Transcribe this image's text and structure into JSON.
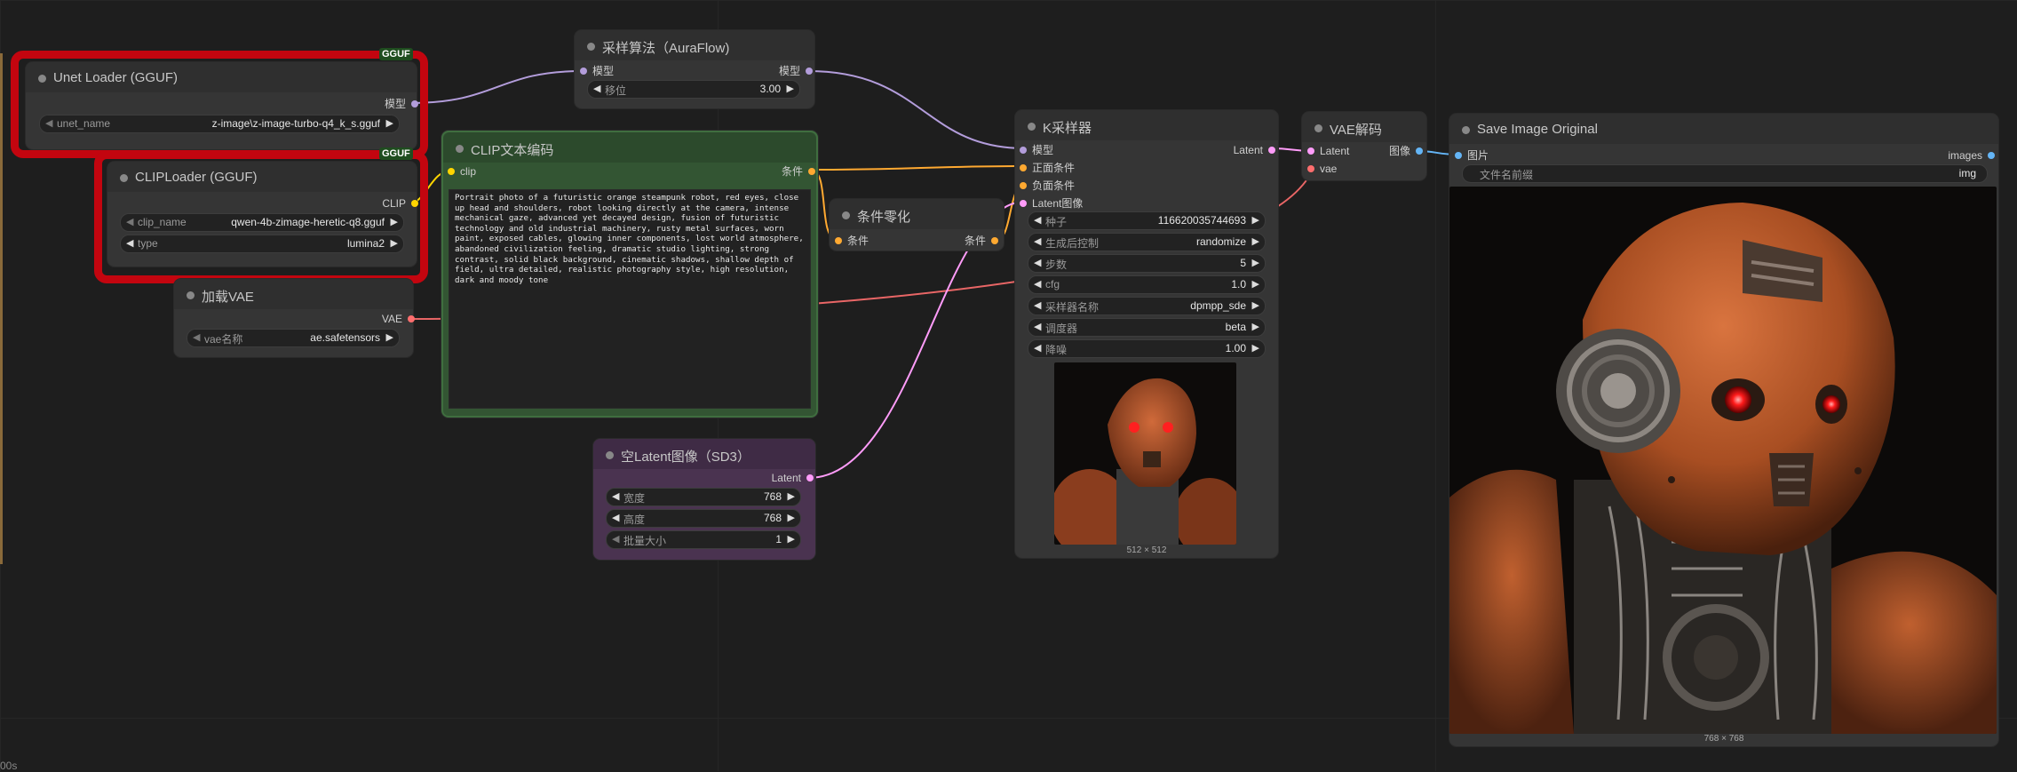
{
  "colors": {
    "canvas": "#1e1e1e",
    "node_body": "#353535",
    "node_header": "#2f2f2f",
    "selection": "#c3050f",
    "model_wire": "#b39ddb",
    "clip_wire": "#ffd500",
    "vae_wire": "#ff6e6e",
    "conditioning_wire": "#ffa931",
    "latent_wire": "#ff9cf9",
    "image_wire": "#64b5f6"
  },
  "nodes": {
    "unet_loader": {
      "badge": "GGUF",
      "title": "Unet Loader (GGUF)",
      "out_model": "模型",
      "w_unet_name_label": "unet_name",
      "w_unet_name_value": "z-image\\z-image-turbo-q4_k_s.gguf"
    },
    "clip_loader": {
      "badge": "GGUF",
      "title": "CLIPLoader (GGUF)",
      "out_clip": "CLIP",
      "w_clip_name_label": "clip_name",
      "w_clip_name_value": "qwen-4b-zimage-heretic-q8.gguf",
      "w_type_label": "type",
      "w_type_value": "lumina2"
    },
    "vae_loader": {
      "title": "加载VAE",
      "out_vae": "VAE",
      "w_vae_label": "vae名称",
      "w_vae_value": "ae.safetensors"
    },
    "sampling_algo": {
      "title": "采样算法（AuraFlow)",
      "in_model": "模型",
      "out_model": "模型",
      "w_shift_label": "移位",
      "w_shift_value": "3.00"
    },
    "clip_text_encode": {
      "title": "CLIP文本编码",
      "in_clip": "clip",
      "out_cond": "条件",
      "prompt": "Portrait photo of a futuristic orange steampunk robot, red eyes, close up head and shoulders, robot looking directly at the camera, intense mechanical gaze, advanced yet decayed design, fusion of futuristic technology and old industrial machinery, rusty metal surfaces, worn paint, exposed cables, glowing inner components, lost world atmosphere, abandoned civilization feeling, dramatic studio lighting, strong contrast, solid black background, cinematic shadows, shallow depth of field, ultra detailed, realistic photography style, high resolution, dark and moody tone"
    },
    "cond_zero": {
      "title": "条件零化",
      "in_cond": "条件",
      "out_cond": "条件"
    },
    "empty_latent": {
      "title": "空Latent图像（SD3）",
      "out_latent": "Latent",
      "w_width_label": "宽度",
      "w_width_value": "768",
      "w_height_label": "高度",
      "w_height_value": "768",
      "w_batch_label": "批量大小",
      "w_batch_value": "1"
    },
    "ksampler": {
      "title": "K采样器",
      "in_model": "模型",
      "in_positive": "正面条件",
      "in_negative": "负面条件",
      "in_latent": "Latent图像",
      "out_latent": "Latent",
      "w_seed_label": "种子",
      "w_seed_value": "116620035744693",
      "w_control_label": "生成后控制",
      "w_control_value": "randomize",
      "w_steps_label": "步数",
      "w_steps_value": "5",
      "w_cfg_label": "cfg",
      "w_cfg_value": "1.0",
      "w_sampler_label": "采样器名称",
      "w_sampler_value": "dpmpp_sde",
      "w_scheduler_label": "调度器",
      "w_scheduler_value": "beta",
      "w_denoise_label": "降噪",
      "w_denoise_value": "1.00",
      "preview_size": "512 × 512"
    },
    "vae_decode": {
      "title": "VAE解码",
      "in_latent": "Latent",
      "in_vae": "vae",
      "out_image": "图像"
    },
    "save_image": {
      "title": "Save Image Original",
      "in_images": "图片",
      "out_images": "images",
      "w_prefix_label": "文件名前缀",
      "w_prefix_value": "img",
      "preview_size": "768 × 768"
    }
  },
  "icons": {
    "decrement": "◀",
    "increment": "▶",
    "collapse": "circle-dot-icon"
  },
  "corner_text": "00s"
}
